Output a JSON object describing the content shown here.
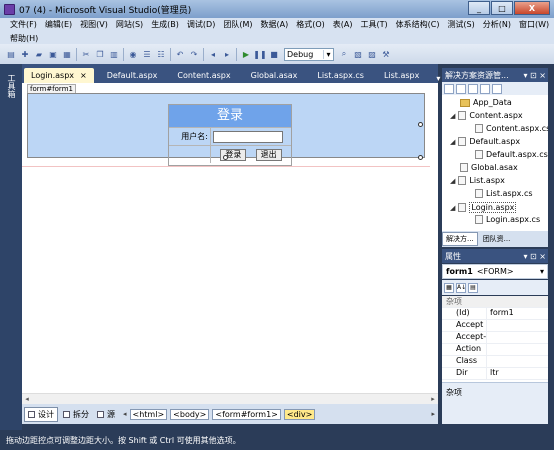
{
  "window": {
    "title": "07 (4) - Microsoft Visual Studio(管理员)",
    "btn_min": "_",
    "btn_max": "□",
    "btn_close": "X"
  },
  "menu": [
    "文件(F)",
    "编辑(E)",
    "视图(V)",
    "网站(S)",
    "生成(B)",
    "调试(D)",
    "团队(M)",
    "数据(A)",
    "格式(O)",
    "表(A)",
    "工具(T)",
    "体系结构(C)",
    "测试(S)",
    "分析(N)",
    "窗口(W)",
    "帮助(H)"
  ],
  "toolbar": {
    "config_value": "Debug"
  },
  "left_tab": "工具箱",
  "doc_tabs": [
    "Login.aspx",
    "Default.aspx",
    "Content.aspx",
    "Global.asax",
    "List.aspx.cs",
    "List.aspx"
  ],
  "doc_tab_close": "×",
  "designer": {
    "form_tag": "form#form1",
    "login_title": "登录",
    "username_label": "用户名:",
    "login_button": "登录",
    "logout_button": "退出"
  },
  "view_tabs": [
    "设计",
    "拆分",
    "源"
  ],
  "breadcrumbs": [
    "<html>",
    "<body>",
    "<form#form1>",
    "<div>"
  ],
  "status_text": "拖动边距控点可调整边距大小。按 Shift 或 Ctrl 可使用其他选项。",
  "solution_explorer": {
    "title": "解决方案资源管...",
    "items": [
      "App_Data",
      "Content.aspx",
      "Content.aspx.cs",
      "Default.aspx",
      "Default.aspx.cs",
      "Global.asax",
      "List.aspx",
      "List.aspx.cs",
      "Login.aspx",
      "Login.aspx.cs"
    ],
    "tabs": [
      "解决方...",
      "团队资..."
    ]
  },
  "properties": {
    "title": "属性",
    "object": "form1",
    "object_type": "<FORM>",
    "category": "杂项",
    "rows": [
      {
        "name": "(Id)",
        "value": "form1"
      },
      {
        "name": "Accept",
        "value": ""
      },
      {
        "name": "Accept-C",
        "value": ""
      },
      {
        "name": "Action",
        "value": ""
      },
      {
        "name": "Class",
        "value": ""
      },
      {
        "name": "Dir",
        "value": "ltr"
      }
    ],
    "description": "杂项"
  }
}
